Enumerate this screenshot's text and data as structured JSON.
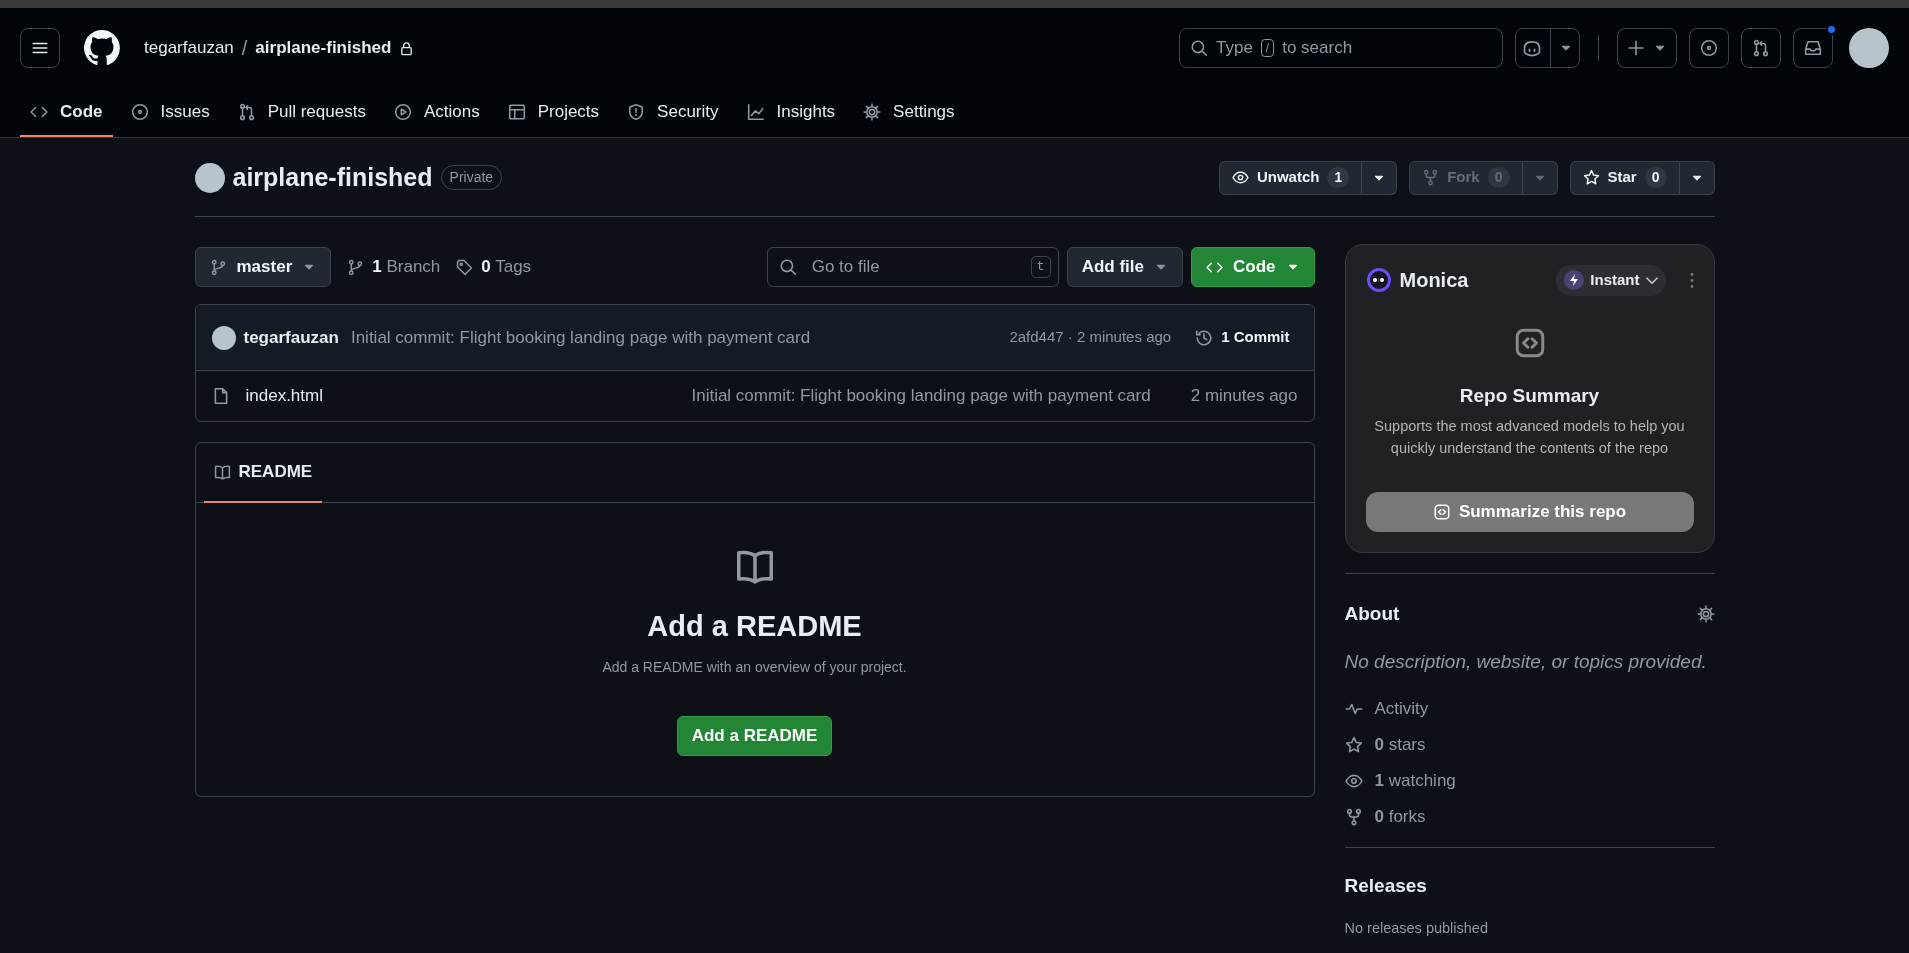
{
  "header": {
    "owner": "tegarfauzan",
    "separator": "/",
    "repo": "airplane-finished",
    "search": {
      "before": "Type",
      "key": "/",
      "after": "to search"
    },
    "inbox_unread": true
  },
  "tabs": [
    {
      "label": "Code",
      "kind": "code",
      "selected": true
    },
    {
      "label": "Issues",
      "kind": "issue",
      "selected": false
    },
    {
      "label": "Pull requests",
      "kind": "pr",
      "selected": false
    },
    {
      "label": "Actions",
      "kind": "play",
      "selected": false
    },
    {
      "label": "Projects",
      "kind": "table",
      "selected": false
    },
    {
      "label": "Security",
      "kind": "shield",
      "selected": false
    },
    {
      "label": "Insights",
      "kind": "graph",
      "selected": false
    },
    {
      "label": "Settings",
      "kind": "gear",
      "selected": false
    }
  ],
  "repo": {
    "name": "airplane-finished",
    "visibility": "Private"
  },
  "repo_actions": [
    {
      "kind": "watch",
      "label": "Unwatch",
      "count": "1",
      "disabled": false
    },
    {
      "kind": "fork",
      "label": "Fork",
      "count": "0",
      "disabled": true
    },
    {
      "kind": "star",
      "label": "Star",
      "count": "0",
      "disabled": false
    }
  ],
  "toolbar": {
    "branch": "master",
    "branches": {
      "count": "1",
      "label": "Branch"
    },
    "tags": {
      "count": "0",
      "label": "Tags"
    },
    "file_search": {
      "placeholder": "Go to file",
      "shortcut": "t"
    },
    "add_file": "Add file",
    "code": "Code"
  },
  "commit": {
    "author": "tegarfauzan",
    "message": "Initial commit: Flight booking landing page with payment card",
    "hash_time": "2afd447 · 2 minutes ago",
    "history": "1 Commit"
  },
  "files": [
    {
      "kind": "file",
      "name": "index.html",
      "message": "Initial commit: Flight booking landing page with payment card",
      "time": "2 minutes ago"
    }
  ],
  "readme": {
    "tab": "README",
    "title": "Add a README",
    "text": "Add a README with an overview of your project.",
    "button": "Add a README"
  },
  "monica": {
    "name": "Monica",
    "mode": "Instant",
    "title": "Repo Summary",
    "description": "Supports the most advanced models to help you quickly understand the contents of the repo",
    "button": "Summarize this repo"
  },
  "about": {
    "title": "About",
    "description": "No description, website, or topics provided.",
    "stats": [
      {
        "kind": "activity",
        "label": "Activity"
      },
      {
        "kind": "star",
        "count": "0",
        "label": "stars"
      },
      {
        "kind": "watch",
        "count": "1",
        "label": "watching"
      },
      {
        "kind": "fork",
        "count": "0",
        "label": "forks"
      }
    ]
  },
  "releases": {
    "title": "Releases",
    "text": "No releases published"
  }
}
